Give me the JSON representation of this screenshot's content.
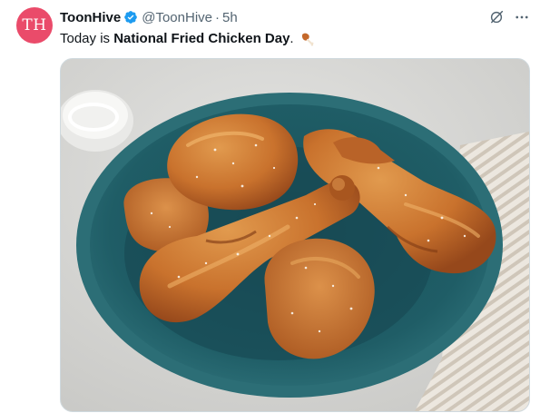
{
  "post": {
    "avatar_initials": "TH",
    "author_name": "ToonHive",
    "author_handle": "@ToonHive",
    "separator": "·",
    "time": "5h",
    "text_prefix": "Today is ",
    "text_bold": "National Fried Chicken Day",
    "text_suffix": "."
  },
  "icons": {
    "verified": "verified-badge-icon",
    "grok": "grok-icon",
    "more": "more-icon",
    "emoji": "poultry-leg-emoji"
  },
  "colors": {
    "avatar": "#ea4b6a",
    "verified": "#1d9bf0",
    "secondary_text": "#536471",
    "plate": "#1f5a63"
  }
}
